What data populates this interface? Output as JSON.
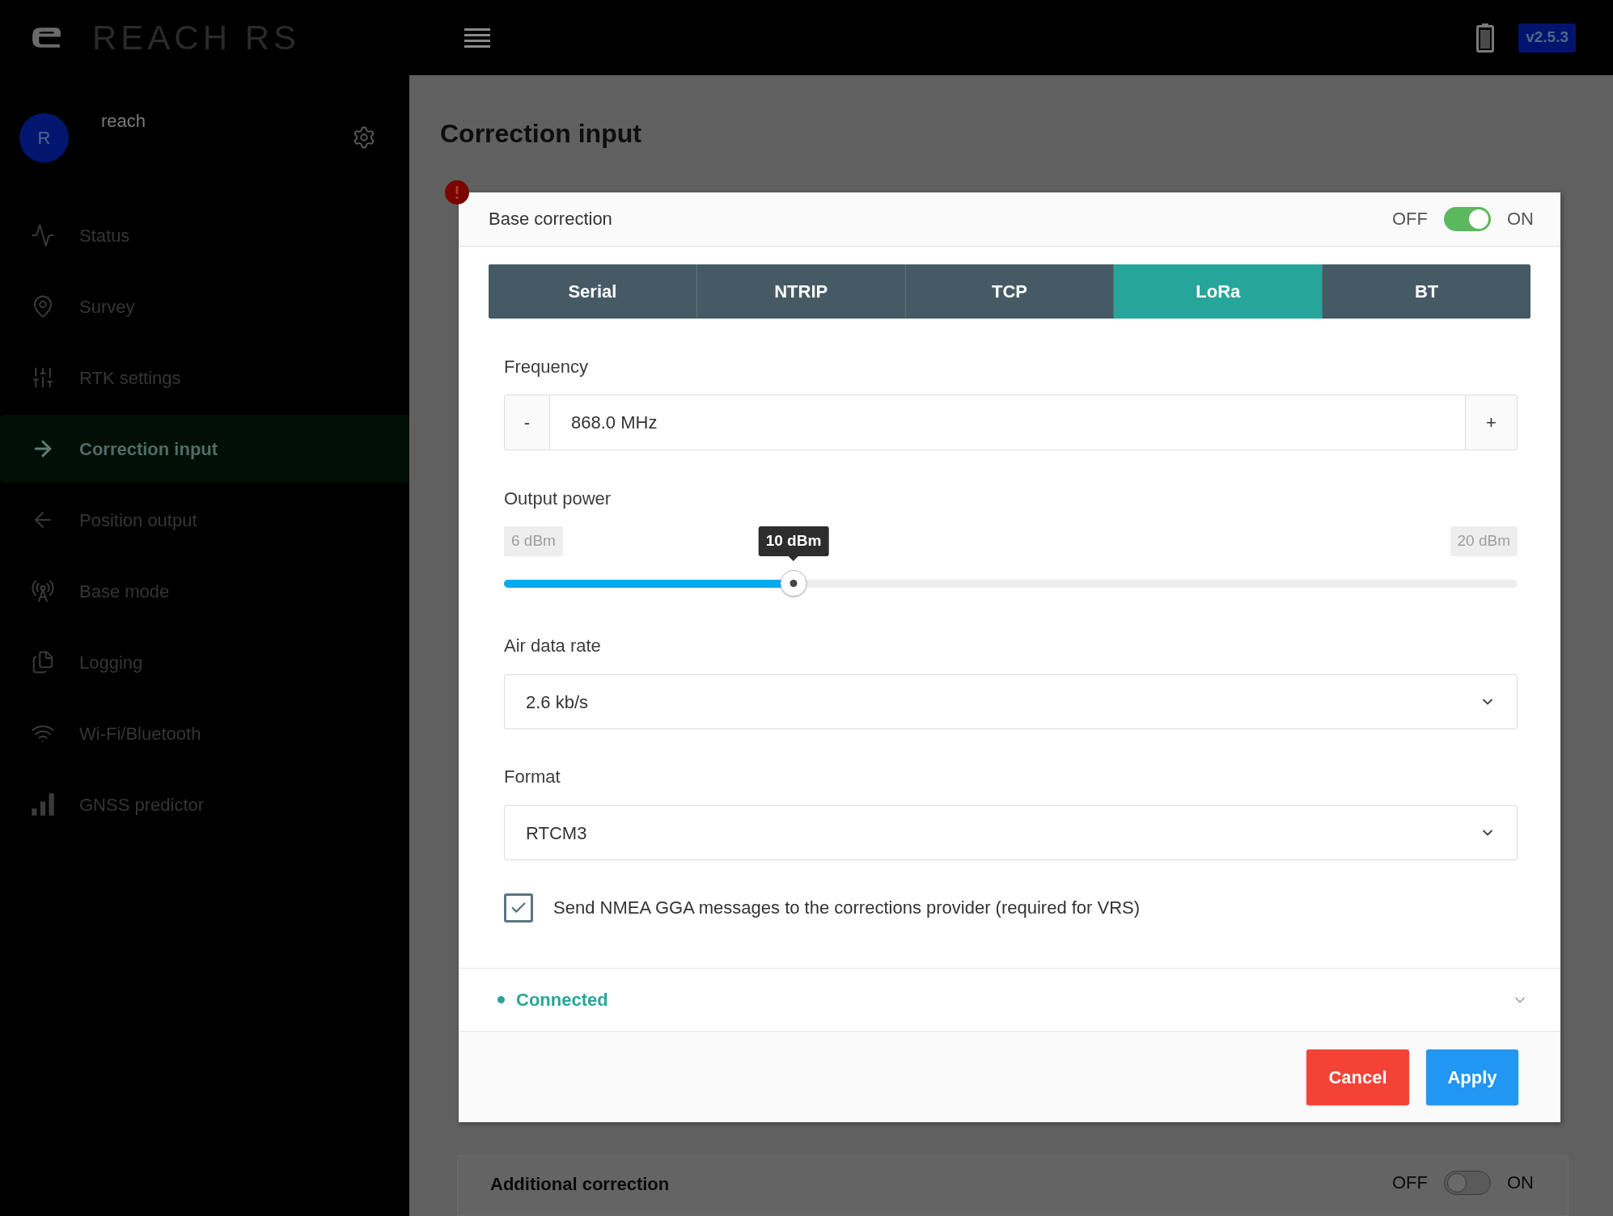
{
  "app_bar": {
    "logo_text": "REACH RS",
    "version": "v2.5.3"
  },
  "sidebar": {
    "user": {
      "initial": "R",
      "name": "reach"
    },
    "items": [
      {
        "label": "Status",
        "selected": false
      },
      {
        "label": "Survey",
        "selected": false
      },
      {
        "label": "RTK settings",
        "selected": false
      },
      {
        "label": "Correction input",
        "selected": true
      },
      {
        "label": "Position output",
        "selected": false
      },
      {
        "label": "Base mode",
        "selected": false
      },
      {
        "label": "Logging",
        "selected": false
      },
      {
        "label": "Wi-Fi/Bluetooth",
        "selected": false
      },
      {
        "label": "GNSS predictor",
        "selected": false
      }
    ]
  },
  "page": {
    "title": "Correction input"
  },
  "base_correction": {
    "title": "Base correction",
    "warning": true,
    "toggle": {
      "off_label": "OFF",
      "on_label": "ON",
      "on": true
    },
    "tabs": [
      {
        "label": "Serial",
        "selected": false
      },
      {
        "label": "NTRIP",
        "selected": false
      },
      {
        "label": "TCP",
        "selected": false
      },
      {
        "label": "LoRa",
        "selected": true
      },
      {
        "label": "BT",
        "selected": false
      }
    ],
    "frequency": {
      "label": "Frequency",
      "decrement": "-",
      "value": "868.0 MHz",
      "increment": "+"
    },
    "output_power": {
      "label": "Output power",
      "min_label": "6 dBm",
      "max_label": "20 dBm",
      "tooltip": "10 dBm",
      "level": 0.2857
    },
    "air_data_rate": {
      "label": "Air data rate",
      "value": "2.6 kb/s"
    },
    "format": {
      "label": "Format",
      "value": "RTCM3"
    },
    "send_gga": {
      "label": "Send NMEA GGA messages to the corrections provider (required for VRS)",
      "checked": true
    },
    "status": {
      "label": "Connected"
    },
    "buttons": [
      {
        "label": "Cancel",
        "kind": "cancel"
      },
      {
        "label": "Apply",
        "kind": "apply"
      }
    ]
  },
  "additional_correction": {
    "title": "Additional correction",
    "toggle": {
      "off_label": "OFF",
      "on_label": "ON",
      "on": false
    }
  }
}
